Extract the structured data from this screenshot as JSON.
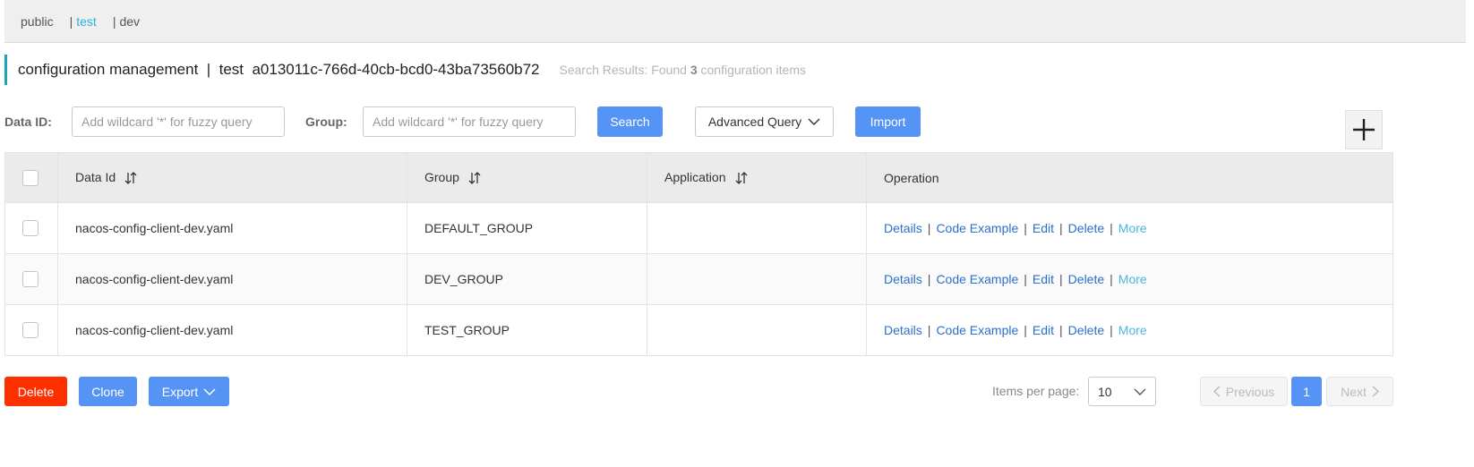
{
  "namespaces": [
    {
      "label": "public",
      "active": false
    },
    {
      "label": "test",
      "active": true
    },
    {
      "label": "dev",
      "active": false
    }
  ],
  "separator": "|",
  "header": {
    "title": "configuration management  |  test  a013011c-766d-40cb-bcd0-43ba73560b72",
    "results_prefix": "Search Results: Found ",
    "results_count": "3",
    "results_suffix": " configuration items"
  },
  "filters": {
    "data_id_label": "Data ID:",
    "data_id_placeholder": "Add wildcard '*' for fuzzy query",
    "group_label": "Group:",
    "group_placeholder": "Add wildcard '*' for fuzzy query",
    "search_label": "Search",
    "advanced_label": "Advanced Query",
    "import_label": "Import"
  },
  "table": {
    "columns": [
      "Data Id",
      "Group",
      "Application",
      "Operation"
    ],
    "rows": [
      {
        "data_id": "nacos-config-client-dev.yaml",
        "group": "DEFAULT_GROUP",
        "application": ""
      },
      {
        "data_id": "nacos-config-client-dev.yaml",
        "group": "DEV_GROUP",
        "application": ""
      },
      {
        "data_id": "nacos-config-client-dev.yaml",
        "group": "TEST_GROUP",
        "application": ""
      }
    ],
    "operations": [
      "Details",
      "Code Example",
      "Edit",
      "Delete",
      "More"
    ]
  },
  "footer": {
    "delete_label": "Delete",
    "clone_label": "Clone",
    "export_label": "Export",
    "items_per_page_label": "Items per page:",
    "page_size": "10",
    "previous_label": "Previous",
    "current_page": "1",
    "next_label": "Next"
  },
  "colors": {
    "primary": "#5593f5",
    "danger": "#ff3000",
    "link": "#2a70c9",
    "active_namespace": "#2eb2d8"
  }
}
